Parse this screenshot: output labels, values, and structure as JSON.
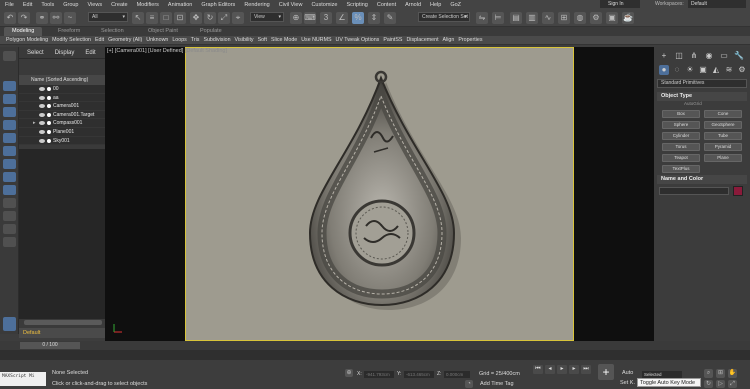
{
  "menu": [
    "File",
    "Edit",
    "Tools",
    "Group",
    "Views",
    "Create",
    "Modifiers",
    "Animation",
    "Graph Editors",
    "Rendering",
    "Civil View",
    "Customize",
    "Scripting",
    "Content",
    "Arnold",
    "Help",
    "GoZ"
  ],
  "account": {
    "signin": "Sign In",
    "workspaces_label": "Workspaces:",
    "workspace": "Default"
  },
  "toolbar": {
    "filter": "All",
    "view": "View",
    "selection_set": "Create Selection Set"
  },
  "ribbon": {
    "tabs": [
      "Modeling",
      "Freeform",
      "Selection",
      "Object Paint",
      "Populate"
    ],
    "active_tab": "Modeling",
    "items": [
      "Polygon Modeling",
      "Modify Selection",
      "Edit",
      "Geometry (All)",
      "Unknown",
      "Loops",
      "Tris",
      "Subdivision",
      "Visibility",
      "Soft",
      "Slice Mode",
      "Use NURMS",
      "UV Tweak Options",
      "PaintSS",
      "Displacement",
      "Align",
      "Properties"
    ]
  },
  "explorer": {
    "tabs": [
      "Select",
      "Display",
      "Edit"
    ],
    "header": "Name (Sorted Ascending)",
    "items": [
      "00",
      "aa",
      "Camera001",
      "Camera001.Target",
      "Compass001",
      "Plane001",
      "Sky001"
    ],
    "layer": "Default"
  },
  "viewport": {
    "label_a": "[+]",
    "label_b": "[Camera001]",
    "label_c": "[User Defined]",
    "label_d": "[Default Shading]"
  },
  "command_panel": {
    "dropdown": "Standard Primitives",
    "object_type": "Object Type",
    "autogrid": "AutoGrid",
    "primitives": [
      "Box",
      "Cone",
      "Sphere",
      "GeoSphere",
      "Cylinder",
      "Tube",
      "Torus",
      "Pyramid",
      "Teapot",
      "Plane",
      "TextPlus"
    ],
    "name_color": "Name and Color"
  },
  "timeline": {
    "frame": "0 / 100"
  },
  "status": {
    "maxscript": "MAXScript Mi",
    "selection": "None Selected",
    "hint": "Click or click-and-drag to select objects",
    "x_label": "X:",
    "x_value": "-941.793cm",
    "y_label": "Y:",
    "y_value": "-613.465cm",
    "z_label": "Z:",
    "z_value": "0.000cm",
    "grid": "Grid = 25/400cm",
    "add_time_tag": "Add Time Tag",
    "auto": "Auto",
    "selected": "Selected",
    "set_k": "Set K.",
    "tooltip": "Toggle Auto Key Mode"
  }
}
